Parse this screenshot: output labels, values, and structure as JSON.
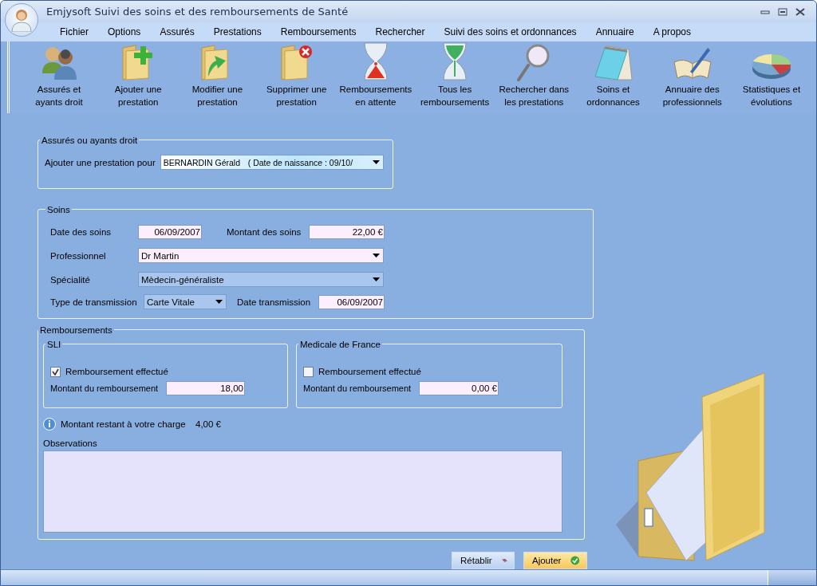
{
  "window": {
    "title": "Emjysoft Suivi des soins et des remboursements de Santé"
  },
  "menu": [
    "Fichier",
    "Options",
    "Assurés",
    "Prestations",
    "Remboursements",
    "Rechercher",
    "Suivi des soins et ordonnances",
    "Annuaire",
    "A propos"
  ],
  "toolbar": [
    {
      "kind": "people",
      "label": "Assurés et\nayants droit"
    },
    {
      "kind": "folder-add",
      "label": "Ajouter une\nprestation"
    },
    {
      "kind": "folder-edit",
      "label": "Modifier une\nprestation"
    },
    {
      "kind": "folder-delete",
      "label": "Supprimer une\nprestation"
    },
    {
      "kind": "hourglass-red",
      "label": "Remboursements\nen attente"
    },
    {
      "kind": "hourglass-green",
      "label": "Tous les\nremboursements"
    },
    {
      "kind": "magnifier",
      "label": "Rechercher dans\nles prestations"
    },
    {
      "kind": "notepad",
      "label": "Soins et\nordonnances"
    },
    {
      "kind": "book",
      "label": "Annuaire des\nprofessionnels"
    },
    {
      "kind": "pie",
      "label": "Statistiques et\névolutions"
    }
  ],
  "insured": {
    "legend": "Assurés ou ayants droit",
    "label": "Ajouter une prestation pour",
    "value": "BERNARDIN Gérald",
    "detail": "( Date de naissance : 09/10/"
  },
  "care": {
    "legend": "Soins",
    "date_label": "Date des soins",
    "date": "06/09/2007",
    "amount_label": "Montant des soins",
    "amount": "22,00 €",
    "professional_label": "Professionnel",
    "professional": "Dr Martin",
    "specialty_label": "Spécialité",
    "specialty": "Mèdecin-généraliste",
    "transmission_label": "Type de transmission",
    "transmission": "Carte Vitale",
    "transmission_date_label": "Date transmission",
    "transmission_date": "06/09/2007"
  },
  "reimbursements": {
    "legend": "Remboursements",
    "insurers": [
      {
        "name": "SLI",
        "checkbox_label": "Remboursement effectué",
        "checked": true,
        "amount_label": "Montant du remboursement",
        "amount": "18,00"
      },
      {
        "name": "Medicale de France",
        "checkbox_label": "Remboursement effectué",
        "checked": false,
        "amount_label": "Montant du remboursement",
        "amount": "0,00 €"
      }
    ],
    "remaining_label": "Montant restant à votre charge",
    "remaining": "4,00 €",
    "observations_label": "Observations"
  },
  "buttons": [
    {
      "kind": "reset",
      "label": "Rétablir"
    },
    {
      "kind": "add",
      "label": "Ajouter"
    }
  ]
}
